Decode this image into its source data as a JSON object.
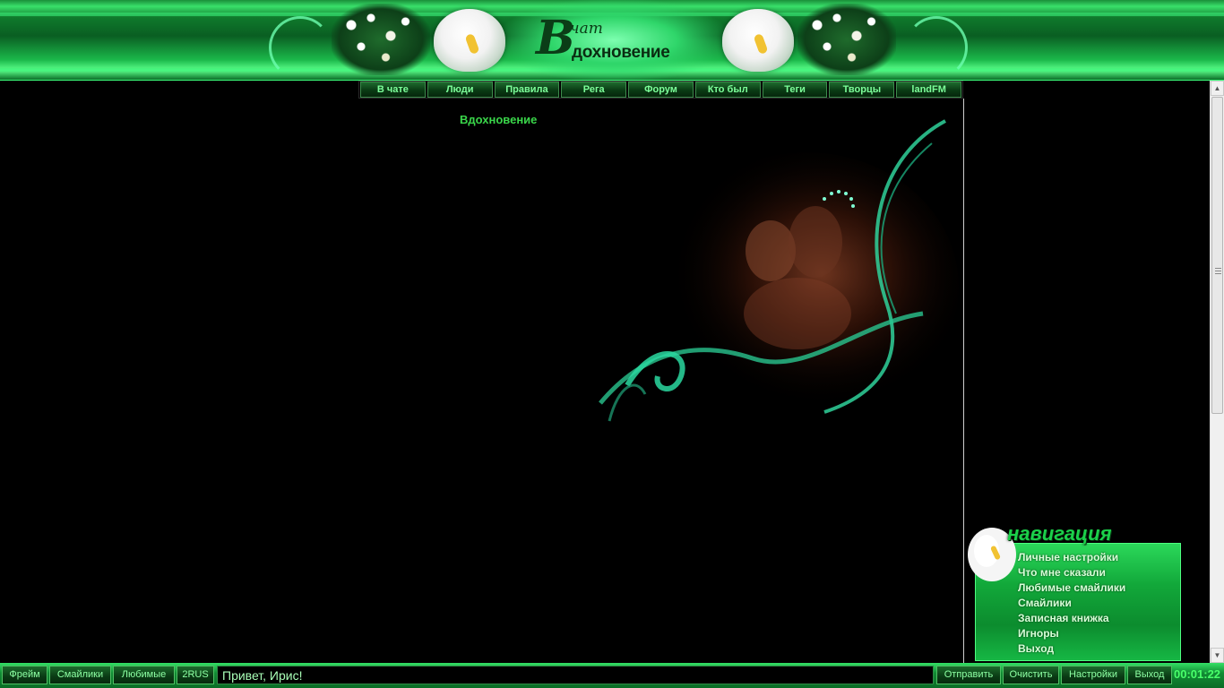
{
  "logo": {
    "letter": "В",
    "script": "чат",
    "word": "дохновение"
  },
  "nav": [
    "В чате",
    "Люди",
    "Правила",
    "Рега",
    "Форум",
    "Кто был",
    "Теги",
    "Творцы",
    "landFM"
  ],
  "room_title": "Вдохновение",
  "navigation_box": {
    "title": "навигация",
    "items": [
      "Личные настройки",
      "Что мне сказали",
      "Любимые смайлики",
      "Смайлики",
      "Записная книжка",
      "Игноры",
      "Выход"
    ]
  },
  "bottom_left_buttons": [
    "Фрейм",
    "Смайлики",
    "Любимые",
    "2RUS"
  ],
  "message_input_value": "Привет, Ирис!",
  "bottom_right_buttons": [
    "Отправить",
    "Очистить",
    "Настройки",
    "Выход"
  ],
  "timer": "00:01:22",
  "colors": {
    "accent": "#1bd04a",
    "text_green": "#7dff9a",
    "background": "#000000"
  },
  "icons": {
    "scroll_up": "arrow-up-icon",
    "scroll_down": "arrow-down-icon"
  }
}
